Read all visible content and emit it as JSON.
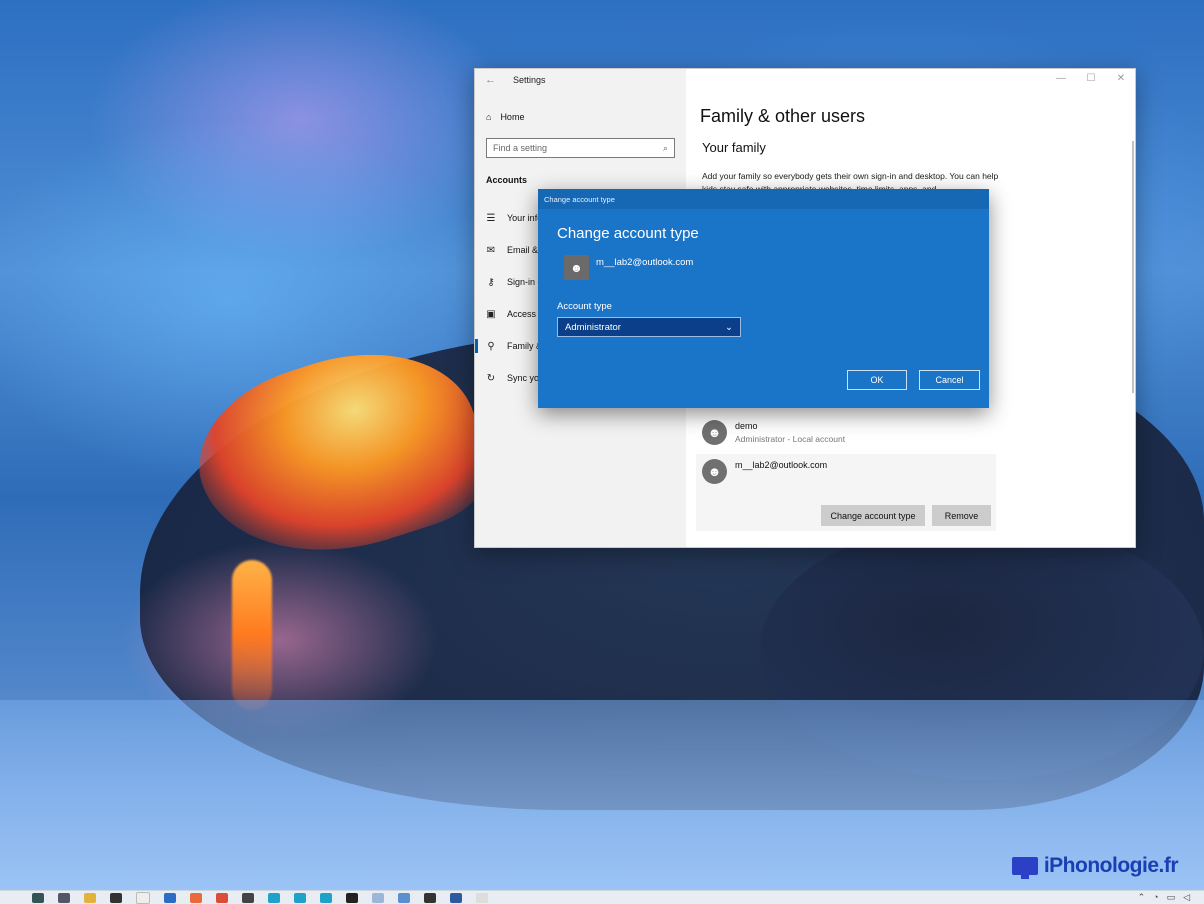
{
  "watermark": {
    "text": "iPhonologie.fr"
  },
  "settings": {
    "title": "Settings",
    "home_label": "Home",
    "search_placeholder": "Find a setting",
    "section": "Accounts",
    "nav_items": [
      {
        "label": "Your info",
        "icon": "person-card-icon"
      },
      {
        "label": "Email & accounts",
        "icon": "mail-icon"
      },
      {
        "label": "Sign-in options",
        "icon": "key-icon"
      },
      {
        "label": "Access work or school",
        "icon": "briefcase-icon"
      },
      {
        "label": "Family & other users",
        "icon": "person-add-icon",
        "active": true
      },
      {
        "label": "Sync your settings",
        "icon": "sync-icon"
      }
    ],
    "page_title": "Family & other users",
    "your_family": "Your family",
    "family_desc": "Add your family so everybody gets their own sign-in and desktop. You can help kids stay safe with appropriate websites, time limits, apps, and",
    "users": [
      {
        "name": "demo",
        "sub": "Administrator - Local account"
      },
      {
        "name": "m__lab2@outlook.com",
        "sub": ""
      }
    ],
    "change_type_button": "Change account type",
    "remove_button": "Remove"
  },
  "dialog": {
    "window_title": "Change account type",
    "heading": "Change account type",
    "account_email": "m__lab2@outlook.com",
    "account_type_label": "Account type",
    "account_type_value": "Administrator",
    "ok_label": "OK",
    "cancel_label": "Cancel"
  },
  "colors": {
    "accent": "#0063b1",
    "dialog_bg": "#1a74c7",
    "select_bg": "#0b3f8a"
  }
}
